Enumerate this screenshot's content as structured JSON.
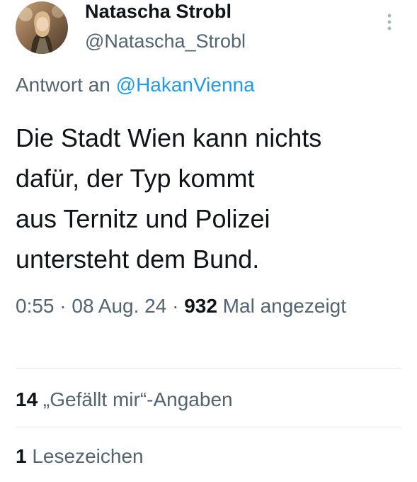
{
  "author": {
    "display_name": "Natascha Strobl",
    "handle": "@Natascha_Strobl"
  },
  "reply": {
    "prefix": "Antwort an ",
    "mention": "@HakanVienna"
  },
  "tweet": {
    "text": "Die Stadt Wien kann nichts\ndafür, der Typ kommt\naus Ternitz und Polizei\nuntersteht dem Bund."
  },
  "meta": {
    "time": "0:55",
    "separator": " · ",
    "date": "08 Aug. 24",
    "views_count": "932",
    "views_label": " Mal angezeigt"
  },
  "stats": {
    "likes_count": "14",
    "likes_label": " „Gefällt mir“-Angaben",
    "bookmarks_count": "1",
    "bookmarks_label": " Lesezeichen"
  },
  "icons": {
    "more": "more-vertical-icon"
  },
  "colors": {
    "text_primary": "#0f1419",
    "text_secondary": "#536471",
    "link": "#1d9bf0",
    "divider": "#e4e8eb"
  }
}
